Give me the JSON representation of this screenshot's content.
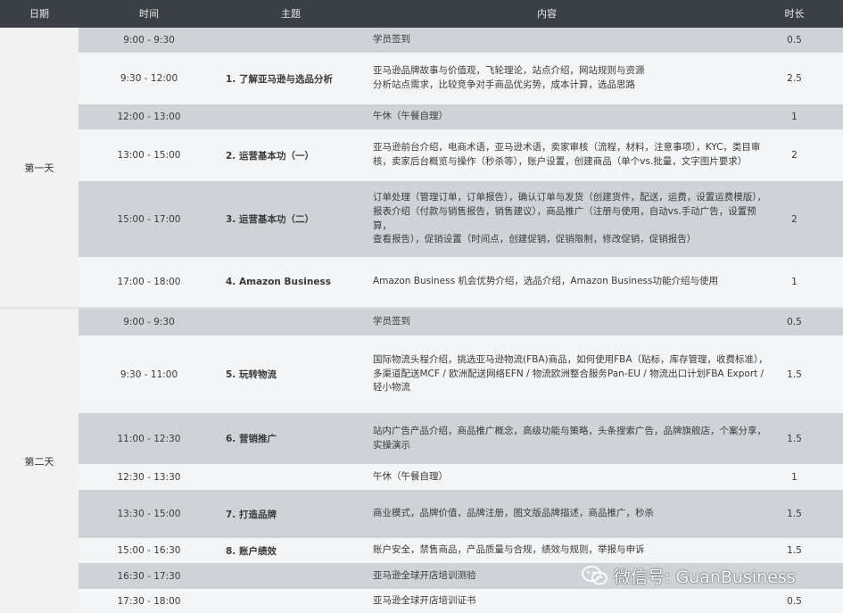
{
  "header": {
    "date": "日期",
    "time": "时间",
    "topic": "主题",
    "content": "内容",
    "duration": "时长"
  },
  "days": [
    "第一天",
    "第二天"
  ],
  "rows": [
    {
      "time": "9:00 - 9:30",
      "topic": "",
      "content": "学员签到",
      "duration": "0.5"
    },
    {
      "time": "9:30 - 12:00",
      "topic": "1. 了解亚马逊与选品分析",
      "content": "亚马逊品牌故事与价值观，飞轮理论，站点介绍，网站规则与资源\n分析站点需求，比较竞争对手商品优劣势，成本计算，选品思路",
      "duration": "2.5"
    },
    {
      "time": "12:00 - 13:00",
      "topic": "",
      "content": "午休（午餐自理）",
      "duration": "1"
    },
    {
      "time": "13:00 - 15:00",
      "topic": "2. 运营基本功（一）",
      "content": "亚马逊前台介绍，电商术语，亚马逊术语，卖家审核（流程，材料，注意事项），KYC，类目审\n核，卖家后台概览与操作（秒杀等），账户设置，创建商品（单个vs.批量，文字图片要求）",
      "duration": "2"
    },
    {
      "time": "15:00 - 17:00",
      "topic": "3. 运营基本功（二）",
      "content": "订单处理（管理订单，订单报告），确认订单与发货（创建货件，配送，运费，设置运费模版），\n报表介绍（付款与销售报告，销售建议），商品推广（注册与使用，自动vs.手动广告，设置预算，\n查看报告），促销设置（时间点，创建促销，促销限制，修改促销，促销报告）",
      "duration": "2"
    },
    {
      "time": "17:00 - 18:00",
      "topic": "4. Amazon Business",
      "content": "Amazon Business 机会优势介绍，选品介绍，Amazon Business功能介绍与使用",
      "duration": "1"
    },
    {
      "time": "9:00 - 9:30",
      "topic": "",
      "content": "学员签到",
      "duration": "0.5"
    },
    {
      "time": "9:30 - 11:00",
      "topic": "5. 玩转物流",
      "content": "国际物流头程介绍，挑选亚马逊物流(FBA)商品，如何使用FBA（贴标，库存管理，收费标准），\n多渠道配送MCF / 欧洲配送网络EFN / 物流欧洲整合服务Pan-EU / 物流出口计划FBA Export /\n轻小物流",
      "duration": "1.5"
    },
    {
      "time": "11:00 - 12:30",
      "topic": "6. 营销推广",
      "content": "站内广告产品介绍，商品推广概念，高级功能与策略，头条搜索广告，品牌旗舰店，个案分享，\n实操演示",
      "duration": "1.5"
    },
    {
      "time": "12:30 - 13:30",
      "topic": "",
      "content": "午休（午餐自理）",
      "duration": "1"
    },
    {
      "time": "13:30 - 15:00",
      "topic": "7. 打造品牌",
      "content": "商业模式，品牌价值，品牌注册，图文版品牌描述，商品推广，秒杀",
      "duration": "1.5"
    },
    {
      "time": "15:00 - 16:30",
      "topic": "8. 账户绩效",
      "content": "账户安全，禁售商品，产品质量与合规，绩效与规则，举报与申诉",
      "duration": "1.5"
    },
    {
      "time": "16:30 - 17:30",
      "topic": "",
      "content": "亚马逊全球开店培训测验",
      "duration": ""
    },
    {
      "time": "17:30 - 18:00",
      "topic": "",
      "content": "亚马逊全球开店培训证书",
      "duration": "0.5"
    }
  ],
  "watermark": {
    "text": "微信号: GuanBusiness",
    "icon": "wechat-icon"
  }
}
